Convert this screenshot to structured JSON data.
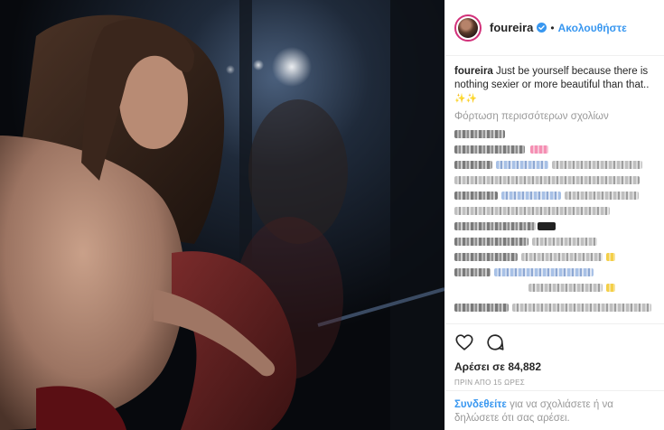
{
  "post": {
    "username": "foureira",
    "dot": "•",
    "follow_label": "Ακολουθήστε",
    "caption_user": "foureira",
    "caption_text": "Just be yourself because there is nothing sexier or more beautiful than that..",
    "caption_emoji": "✨✨",
    "load_more": "Φόρτωση περισσότερων σχολίων",
    "likes": "Αρέσει σε 84,882",
    "time": "ΠΡΙΝ ΑΠΟ 15 ΩΡΕΣ",
    "login_link": "Συνδεθείτε",
    "login_text": "για να σχολιάσετε ή να δηλώσετε ότι σας αρέσει."
  },
  "icons": {
    "verified": "verified-badge-icon",
    "like": "heart-icon",
    "comment": "comment-bubble-icon"
  },
  "colors": {
    "accent": "#3897f0",
    "text": "#262626",
    "muted": "#999999",
    "border": "#efefef"
  }
}
